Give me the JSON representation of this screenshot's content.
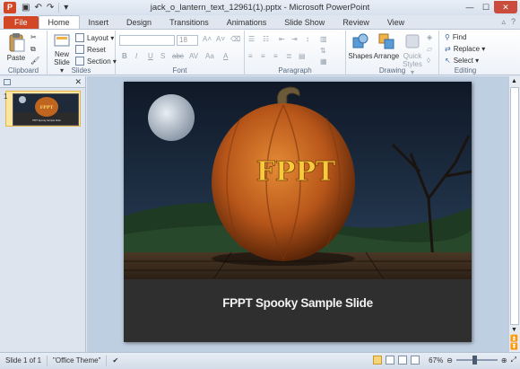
{
  "window": {
    "title": "jack_o_lantern_text_12961(1).pptx - Microsoft PowerPoint",
    "app_icon": "P"
  },
  "tabs": [
    "File",
    "Home",
    "Insert",
    "Design",
    "Transitions",
    "Animations",
    "Slide Show",
    "Review",
    "View"
  ],
  "ribbon": {
    "clipboard": {
      "paste": "Paste",
      "label": "Clipboard"
    },
    "slides": {
      "new_slide": "New",
      "new_slide_line2": "Slide ▾",
      "layout": "Layout ▾",
      "reset": "Reset",
      "section": "Section ▾",
      "label": "Slides"
    },
    "font": {
      "size": "18",
      "label": "Font",
      "bold": "B",
      "italic": "I",
      "underline": "U",
      "shadow": "S",
      "strike": "abc",
      "spacing": "AV",
      "case": "Aa",
      "color": "A"
    },
    "paragraph": {
      "label": "Paragraph"
    },
    "drawing": {
      "shapes": "Shapes",
      "arrange": "Arrange",
      "quick_styles": "Quick",
      "quick_styles_line2": "Styles ▾",
      "label": "Drawing"
    },
    "editing": {
      "find": "Find",
      "replace": "Replace ▾",
      "select": "Select ▾",
      "label": "Editing"
    }
  },
  "left_pane": {
    "slide_number": "1",
    "thumb_title": "FPPT",
    "thumb_caption": "FPPT Spooky Sample Slide"
  },
  "slide": {
    "pumpkin_text": "FPPT",
    "caption": "FPPT Spooky Sample Slide"
  },
  "status": {
    "slide_info": "Slide 1 of 1",
    "theme": "\"Office Theme\"",
    "zoom": "67%"
  }
}
